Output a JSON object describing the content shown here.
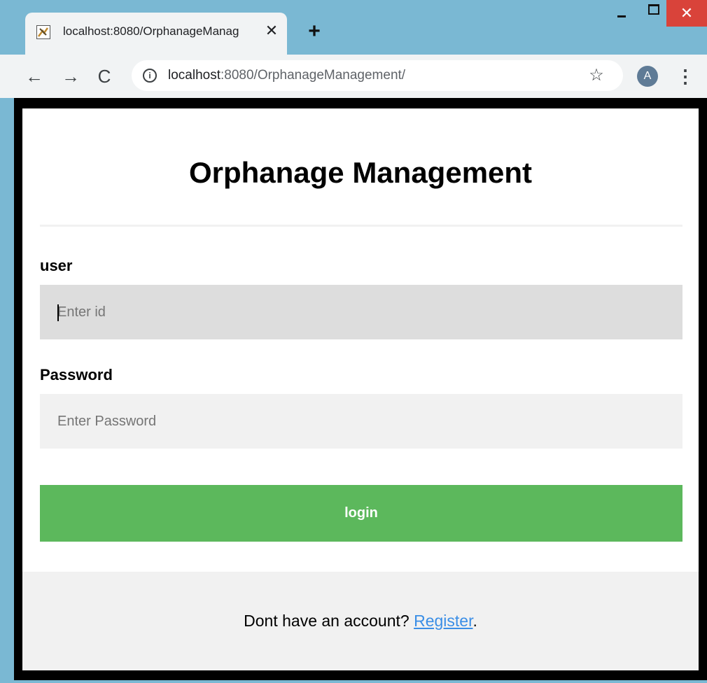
{
  "browser": {
    "tab_title": "localhost:8080/OrphanageManag",
    "tab_close": "✕",
    "new_tab": "+",
    "close_window": "✕",
    "url_host": "localhost",
    "url_rest": ":8080/OrphanageManagement/",
    "avatar_letter": "A",
    "icons": {
      "back": "←",
      "forward": "→",
      "reload": "C",
      "info": "i",
      "star": "☆",
      "menu": "⋮"
    }
  },
  "page": {
    "title": "Orphanage Management",
    "user_label": "user",
    "user_placeholder": "Enter id",
    "password_label": "Password",
    "password_placeholder": "Enter Password",
    "login_label": "login",
    "footer_prefix": "Dont have an account? ",
    "register_link": "Register",
    "footer_suffix": "."
  },
  "colors": {
    "login_button": "#5cb85c",
    "link": "#3a8ee6",
    "window_frame": "#7ab8d3",
    "close_button": "#d9433a"
  }
}
